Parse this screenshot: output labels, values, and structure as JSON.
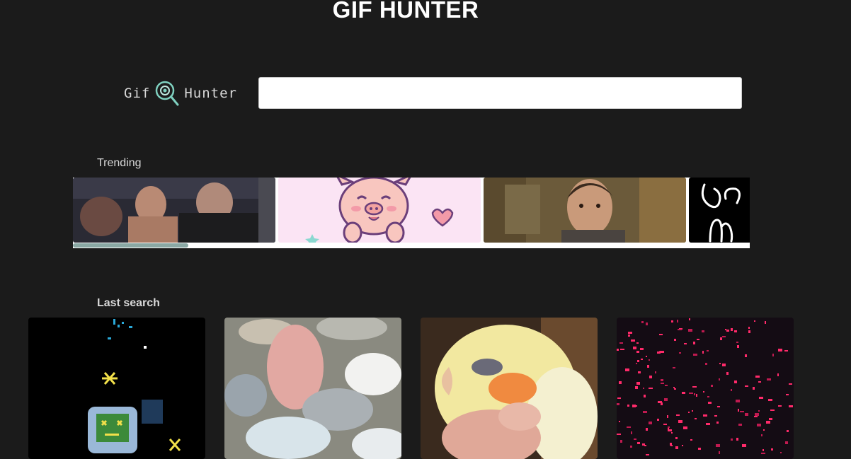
{
  "app": {
    "title": "GIF HUNTER"
  },
  "logo": {
    "left_text": "Gif",
    "right_text": "Hunter",
    "icon": "magnifier-eye-icon"
  },
  "search": {
    "value": "",
    "placeholder": ""
  },
  "trending": {
    "title": "Trending",
    "items": [
      {
        "name": "boxing-crowd-gif"
      },
      {
        "name": "cute-pig-gif"
      },
      {
        "name": "man-stare-gif"
      },
      {
        "name": "script-text-gif"
      }
    ],
    "scroll_fraction": 0.17
  },
  "last_search": {
    "title": "Last search",
    "items": [
      {
        "name": "pixel-astronaut-gif"
      },
      {
        "name": "painted-clouds-gif"
      },
      {
        "name": "cockatiel-gif"
      },
      {
        "name": "pink-particles-gif"
      }
    ]
  },
  "colors": {
    "background": "#1b1b1b",
    "accent": "#7fd1c0",
    "text": "#ffffff"
  }
}
